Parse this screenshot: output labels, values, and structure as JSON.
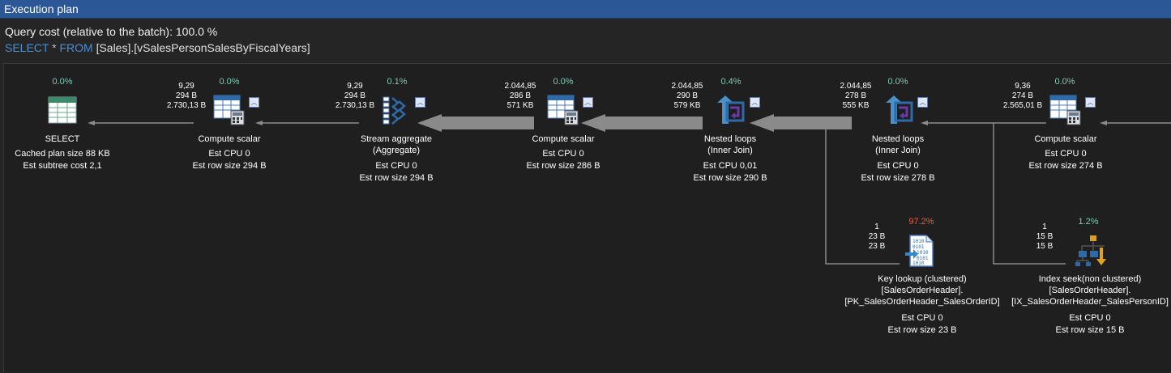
{
  "window": {
    "title": "Execution plan"
  },
  "query": {
    "cost_text": "Query cost (relative to the batch):  100.0 %",
    "kw_select": "SELECT",
    "kw_star": "*",
    "kw_from": "FROM",
    "target": "[Sales].[vSalesPersonSalesByFiscalYears]"
  },
  "nodes": {
    "select": {
      "pct": "0.0%",
      "label1": "SELECT",
      "m1": "Cached plan size  88 KB",
      "m2": "Est subtree cost  2,1"
    },
    "compute1": {
      "pct": "0.0%",
      "rows": "9,29",
      "size": "294 B",
      "total": "2.730,13 B",
      "label1": "Compute scalar",
      "m1": "Est CPU  0",
      "m2": "Est row size  294 B"
    },
    "stream": {
      "pct": "0.1%",
      "rows": "9,29",
      "size": "294 B",
      "total": "2.730,13 B",
      "label1": "Stream aggregate",
      "label2": "(Aggregate)",
      "m1": "Est CPU  0",
      "m2": "Est row size  294 B"
    },
    "compute2": {
      "pct": "0.0%",
      "rows": "2.044,85",
      "size": "286 B",
      "total": "571 KB",
      "label1": "Compute scalar",
      "m1": "Est CPU  0",
      "m2": "Est row size  286 B"
    },
    "nested1": {
      "pct": "0.4%",
      "rows": "2.044,85",
      "size": "290 B",
      "total": "579 KB",
      "label1": "Nested loops",
      "label2": "(Inner Join)",
      "m1": "Est CPU  0,01",
      "m2": "Est row size  290 B"
    },
    "nested2": {
      "pct": "0.0%",
      "rows": "2.044,85",
      "size": "278 B",
      "total": "555 KB",
      "label1": "Nested loops",
      "label2": "(Inner Join)",
      "m1": "Est CPU  0",
      "m2": "Est row size  278 B"
    },
    "compute3": {
      "pct": "0.0%",
      "rows": "9,36",
      "size": "274 B",
      "total": "2.565,01 B",
      "label1": "Compute scalar",
      "m1": "Est CPU  0",
      "m2": "Est row size  274 B"
    },
    "keylookup": {
      "pct": "97.2%",
      "rows": "1",
      "size": "23 B",
      "total": "23 B",
      "label1": "Key lookup (clustered)",
      "label2": "[SalesOrderHeader].",
      "label3": "[PK_SalesOrderHeader_SalesOrderID]",
      "m1": "Est CPU  0",
      "m2": "Est row size  23 B"
    },
    "indexseek": {
      "pct": "1.2%",
      "rows": "1",
      "size": "15 B",
      "total": "15 B",
      "label1": "Index seek(non clustered)",
      "label2": "[SalesOrderHeader].",
      "label3": "[IX_SalesOrderHeader_SalesPersonID]",
      "m1": "Est CPU  0",
      "m2": "Est row size  15 B"
    }
  },
  "icons": {
    "select": "table-grid-icon",
    "compute": "compute-scalar-icon",
    "stream": "stream-aggregate-icon",
    "nested": "nested-loops-icon",
    "keylookup": "key-lookup-icon",
    "indexseek": "index-seek-icon",
    "collapse": "collapse-toggle-icon"
  },
  "colors": {
    "titlebar": "#2b5797",
    "pct_normal": "#7fc8b4",
    "pct_hot": "#e06040",
    "keyword": "#4a8fd4",
    "arrow": "#8a8a8a"
  }
}
